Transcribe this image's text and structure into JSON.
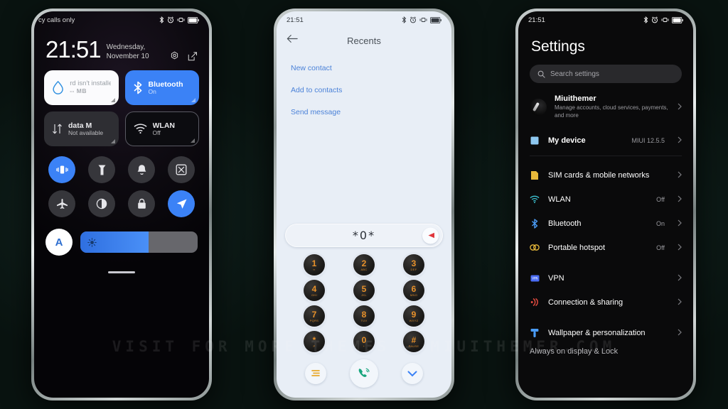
{
  "background": {
    "color": "#091310"
  },
  "watermark": {
    "text": "VISIT FOR MORE THEMES - MIUITHEMER.COM"
  },
  "phone1": {
    "statusbar": {
      "carrier": "cy calls only",
      "icons": [
        "bluetooth-icon",
        "alarm-icon",
        "vibrate-icon",
        "battery-icon"
      ]
    },
    "clock": {
      "time": "21:51",
      "date": "Wednesday, November 10"
    },
    "header_icons": [
      "settings-gear-icon",
      "edit-icon"
    ],
    "tiles": [
      {
        "title": "rd isn't installe",
        "sub": "-- MB",
        "style": "white",
        "icon": "data-drop-icon"
      },
      {
        "title": "Bluetooth",
        "sub": "On",
        "style": "blue",
        "icon": "bluetooth-icon"
      },
      {
        "title": "data     M",
        "sub": "Not available",
        "style": "grey",
        "icon": "mobile-data-icon"
      },
      {
        "title": "WLAN",
        "sub": "Off",
        "style": "outline",
        "icon": "wifi-icon"
      }
    ],
    "toggles": [
      {
        "icon": "vibrate-icon",
        "state": "on"
      },
      {
        "icon": "flashlight-icon",
        "state": "off"
      },
      {
        "icon": "bell-icon",
        "state": "off"
      },
      {
        "icon": "screenshot-icon",
        "state": "off"
      },
      {
        "icon": "airplane-icon",
        "state": "off"
      },
      {
        "icon": "dark-mode-icon",
        "state": "off"
      },
      {
        "icon": "lock-icon",
        "state": "off"
      },
      {
        "icon": "location-icon",
        "state": "on"
      }
    ],
    "brightness": {
      "auto_label": "A",
      "icon": "sun-icon",
      "percent": 58
    }
  },
  "phone2": {
    "statusbar": {
      "time": "21:51",
      "icons": [
        "bluetooth-icon",
        "alarm-icon",
        "vibrate-icon",
        "battery-icon"
      ]
    },
    "header": {
      "title": "Recents",
      "back_icon": "back-arrow-icon"
    },
    "actions": [
      "New contact",
      "Add to contacts",
      "Send message"
    ],
    "dial_input": {
      "value": "*0*",
      "delete_icon": "backspace-icon"
    },
    "keypad": [
      {
        "num": "1",
        "sub": "∞"
      },
      {
        "num": "2",
        "sub": "ABC"
      },
      {
        "num": "3",
        "sub": "DEF"
      },
      {
        "num": "4",
        "sub": "GHI"
      },
      {
        "num": "5",
        "sub": "JKL"
      },
      {
        "num": "6",
        "sub": "MNO"
      },
      {
        "num": "7",
        "sub": "PQRS"
      },
      {
        "num": "8",
        "sub": "TUV"
      },
      {
        "num": "9",
        "sub": "WXYZ"
      },
      {
        "num": "*",
        "sub": "P"
      },
      {
        "num": "0",
        "sub": "+"
      },
      {
        "num": "#",
        "sub": "PAUSE"
      }
    ],
    "bottom_bar": [
      "menu-list-icon",
      "call-icon",
      "chevron-down-icon"
    ]
  },
  "phone3": {
    "statusbar": {
      "time": "21:51",
      "icons": [
        "bluetooth-icon",
        "alarm-icon",
        "vibrate-icon",
        "battery-icon"
      ]
    },
    "title": "Settings",
    "search": {
      "placeholder": "Search settings",
      "icon": "search-icon"
    },
    "account": {
      "name": "Miuithemer",
      "sub": "Manage accounts, cloud services, payments, and more"
    },
    "device": {
      "label": "My device",
      "value": "MIUI 12.5.5",
      "icon": "device-icon"
    },
    "rows": [
      {
        "label": "SIM cards & mobile networks",
        "value": "",
        "icon": "sim-icon",
        "color": "#e8b93a"
      },
      {
        "label": "WLAN",
        "value": "Off",
        "icon": "wifi-icon",
        "color": "#3ec8d8"
      },
      {
        "label": "Bluetooth",
        "value": "On",
        "icon": "bluetooth-icon",
        "color": "#4a9bf5"
      },
      {
        "label": "Portable hotspot",
        "value": "Off",
        "icon": "hotspot-icon",
        "color": "#e8b93a"
      },
      {
        "label": "VPN",
        "value": "",
        "icon": "vpn-icon",
        "color": "#4a6cf5"
      },
      {
        "label": "Connection & sharing",
        "value": "",
        "icon": "sharing-icon",
        "color": "#e04a3f"
      },
      {
        "label": "Wallpaper & personalization",
        "value": "",
        "icon": "brush-icon",
        "color": "#4a9bf5"
      }
    ],
    "cutoff_row": {
      "label": "Always on display & Lock"
    }
  }
}
